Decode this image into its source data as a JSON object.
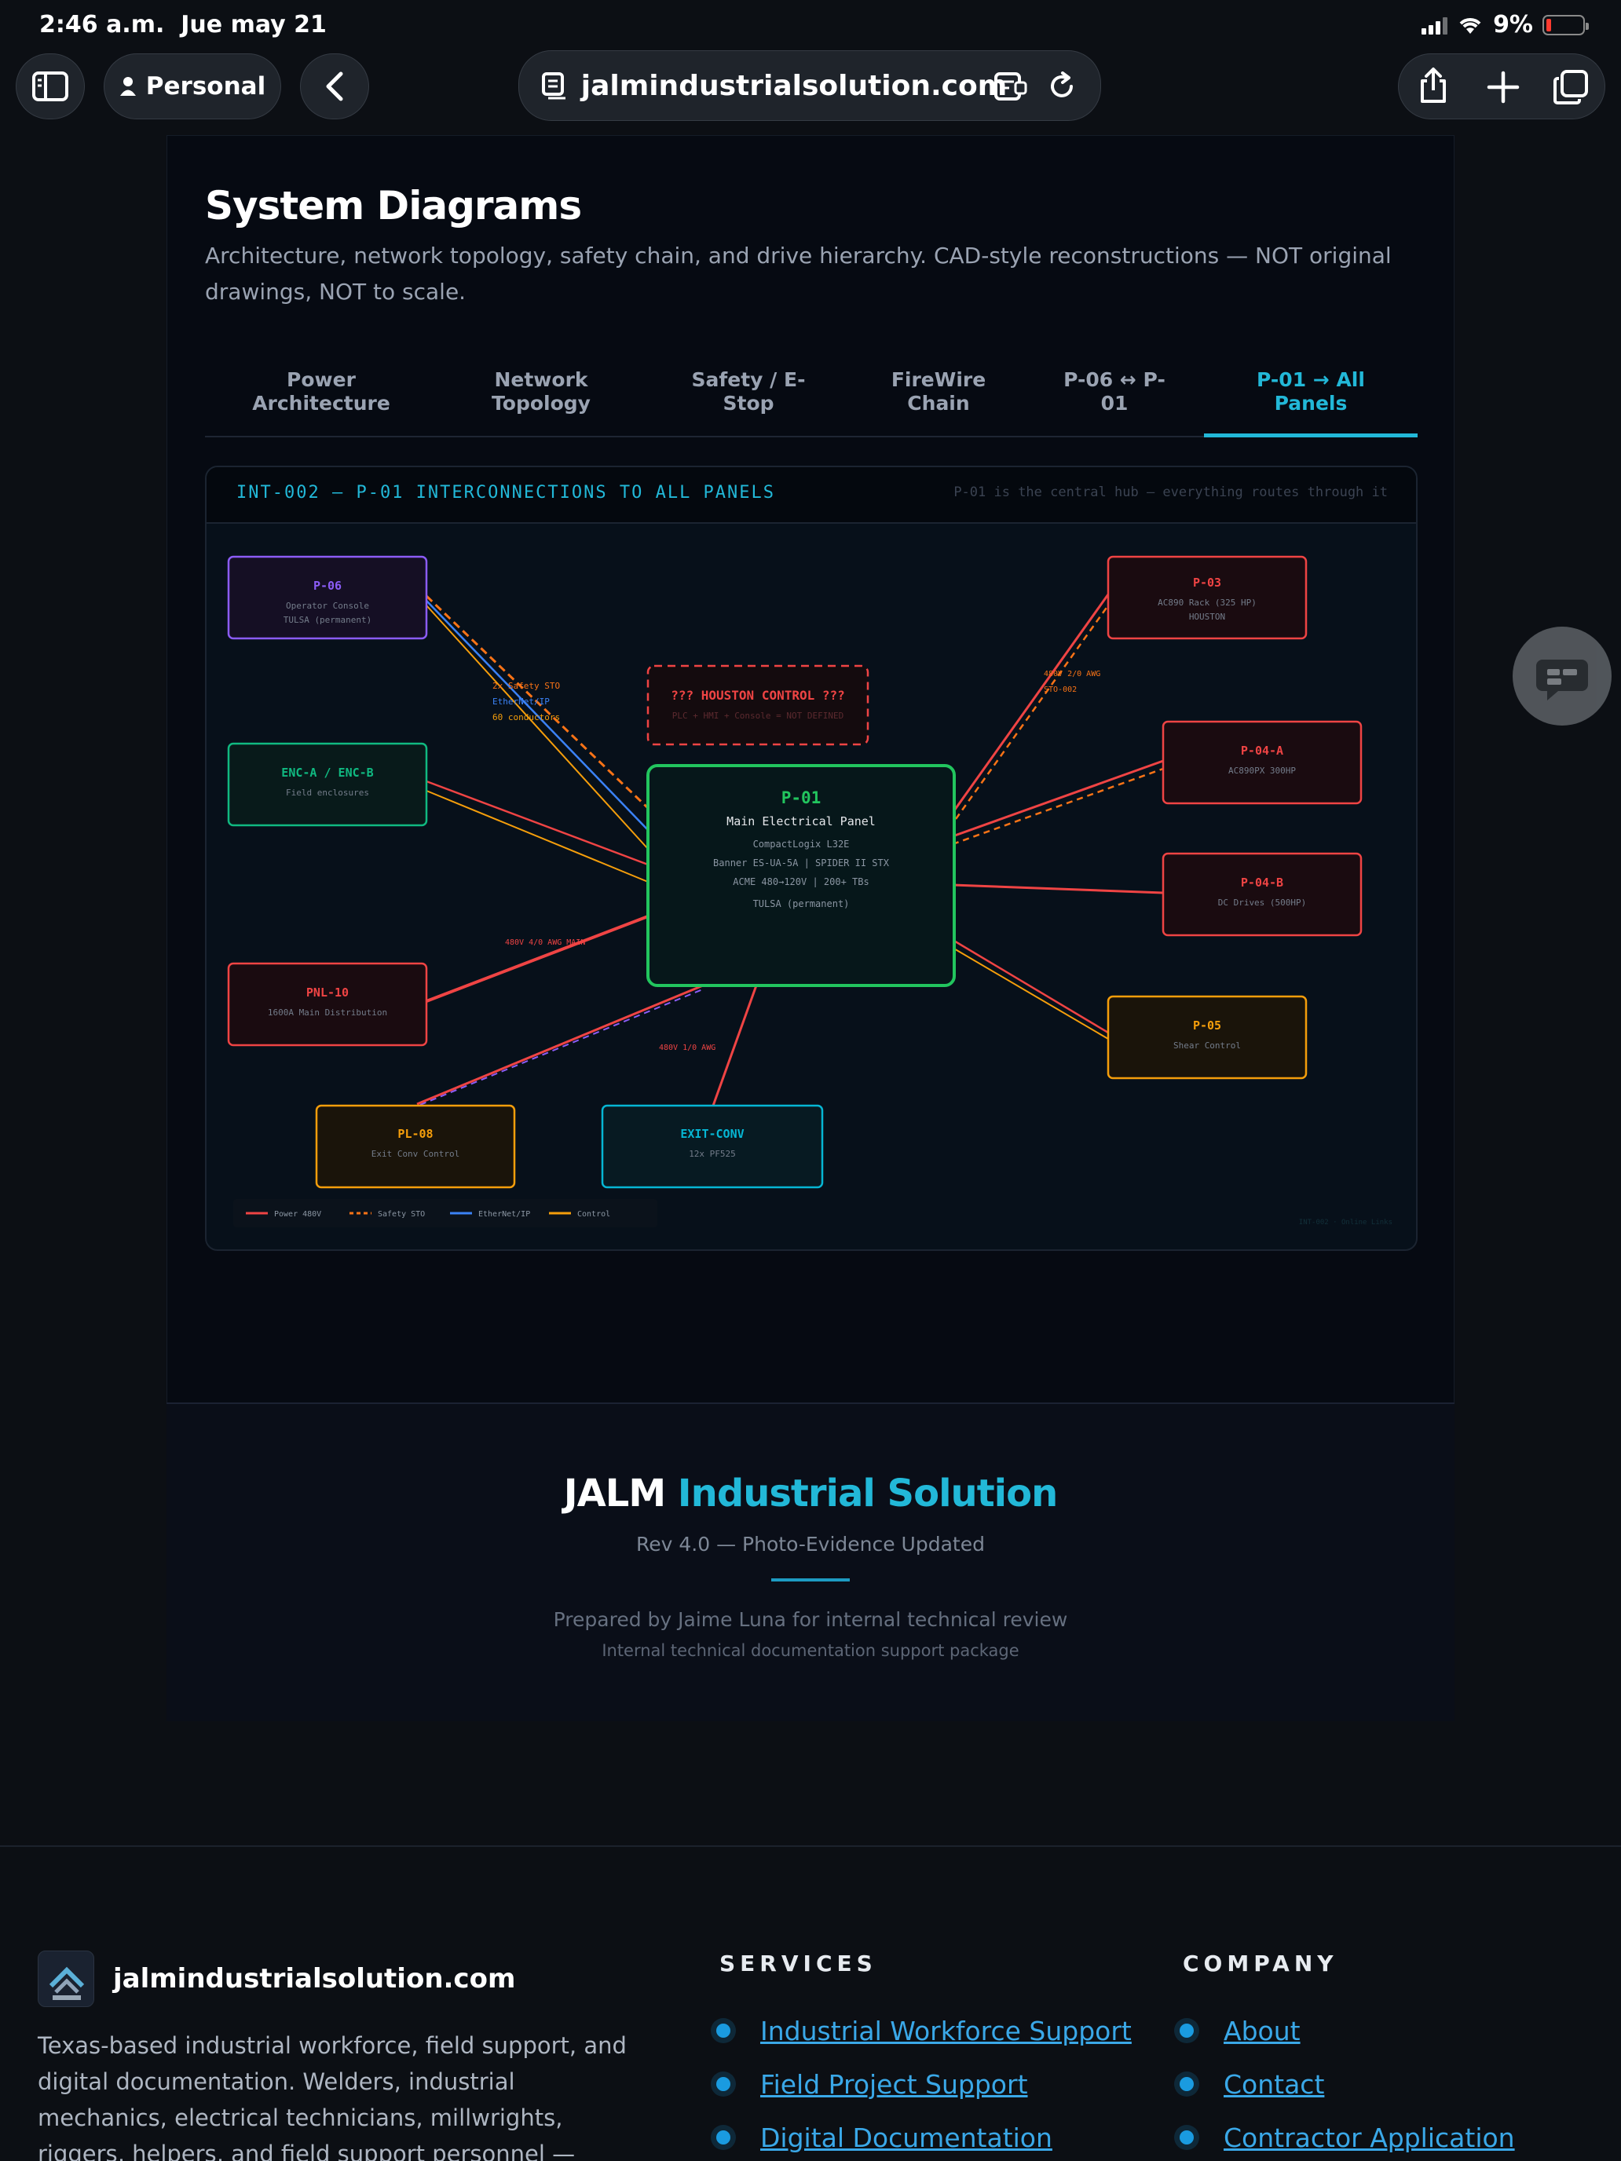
{
  "status_bar": {
    "time": "2:46 a.m.",
    "date": "Jue may 21",
    "battery": "9%",
    "battery_level": 0.09
  },
  "browser": {
    "profile": "Personal",
    "url": "jalmindustrialsolution.com"
  },
  "section": {
    "title": "System Diagrams",
    "subtitle": "Architecture, network topology, safety chain, and drive hierarchy. CAD-style reconstructions — NOT original drawings, NOT to scale."
  },
  "tabs": [
    {
      "l1": "Power",
      "l2": "Architecture"
    },
    {
      "l1": "Network",
      "l2": "Topology"
    },
    {
      "l1": "Safety / E-",
      "l2": "Stop"
    },
    {
      "l1": "FireWire",
      "l2": "Chain"
    },
    {
      "l1": "P-06 ↔ P-",
      "l2": "01"
    },
    {
      "l1": "P-01 → All",
      "l2": "Panels"
    }
  ],
  "diagram": {
    "title": "INT-002 — P-01 INTERCONNECTIONS TO ALL PANELS",
    "note": "P-01 is the central hub — everything routes through it",
    "hub": {
      "id": "P-01",
      "name": "Main Electrical Panel",
      "l1": "CompactLogix L32E",
      "l2": "Banner ES-UA-5A | SPIDER II STX",
      "l3": "ACME 480→120V | 200+ TBs",
      "l4": "TULSA (permanent)"
    },
    "houston": {
      "title": "??? HOUSTON CONTROL ???",
      "sub": "PLC + HMI + Console = NOT DEFINED"
    },
    "nodes": {
      "p06": {
        "id": "P-06",
        "l1": "Operator Console",
        "l2": "TULSA (permanent)"
      },
      "enc": {
        "id": "ENC-A / ENC-B",
        "l1": "Field enclosures"
      },
      "pnl10": {
        "id": "PNL-10",
        "l1": "1600A Main Distribution"
      },
      "pl08": {
        "id": "PL-08",
        "l1": "Exit Conv Control"
      },
      "exitconv": {
        "id": "EXIT-CONV",
        "l1": "12x PF525"
      },
      "p03": {
        "id": "P-03",
        "l1": "AC890 Rack (325 HP)",
        "l2": "HOUSTON"
      },
      "p04a": {
        "id": "P-04-A",
        "l1": "AC890PX 300HP"
      },
      "p04b": {
        "id": "P-04-B",
        "l1": "DC Drives (500HP)"
      },
      "p05": {
        "id": "P-05",
        "l1": "Shear Control"
      }
    },
    "wire_labels": {
      "sto": "2x Safety STO",
      "eth": "EtherNet/IP",
      "ctrl": "60 conductors",
      "pnl10": "480V 4/0 AWG MAIN",
      "exit": "480V 1/0 AWG",
      "p03a": "480V 2/0 AWG",
      "p03b": "STO-002"
    },
    "legend": [
      {
        "label": "Power 480V",
        "color": "#ef4444",
        "dashed": false
      },
      {
        "label": "Safety STO",
        "color": "#f97316",
        "dashed": true
      },
      {
        "label": "EtherNet/IP",
        "color": "#3b82f6",
        "dashed": false
      },
      {
        "label": "Control",
        "color": "#f59e0b",
        "dashed": false
      }
    ],
    "corner": "INT-002 · Online Links",
    "colors": {
      "power": "#ef4444",
      "safety": "#f97316",
      "ethernet": "#3b82f6",
      "control": "#f59e0b",
      "hub": "#22c55e",
      "violet": "#8b5cf6",
      "cyan": "#06b6d4",
      "amber": "#f59e0b"
    }
  },
  "doc_footer": {
    "brand_a": "JALM",
    "brand_b": "Industrial Solution",
    "rev": "Rev 4.0 — Photo-Evidence Updated",
    "prepared": "Prepared by Jaime Luna for internal technical review",
    "package": "Internal technical documentation support package"
  },
  "site_footer": {
    "site": "jalmindustrialsolution.com",
    "description": "Texas-based industrial workforce, field support, and digital documentation. Welders, industrial mechanics, electrical technicians, millwrights, riggers, helpers, and field support personnel — engaged through a contractor-",
    "services_title": "SERVICES",
    "services": [
      "Industrial Workforce Support",
      "Field Project Support",
      "Digital Documentation"
    ],
    "company_title": "COMPANY",
    "company": [
      "About",
      "Contact",
      "Contractor Application"
    ]
  }
}
